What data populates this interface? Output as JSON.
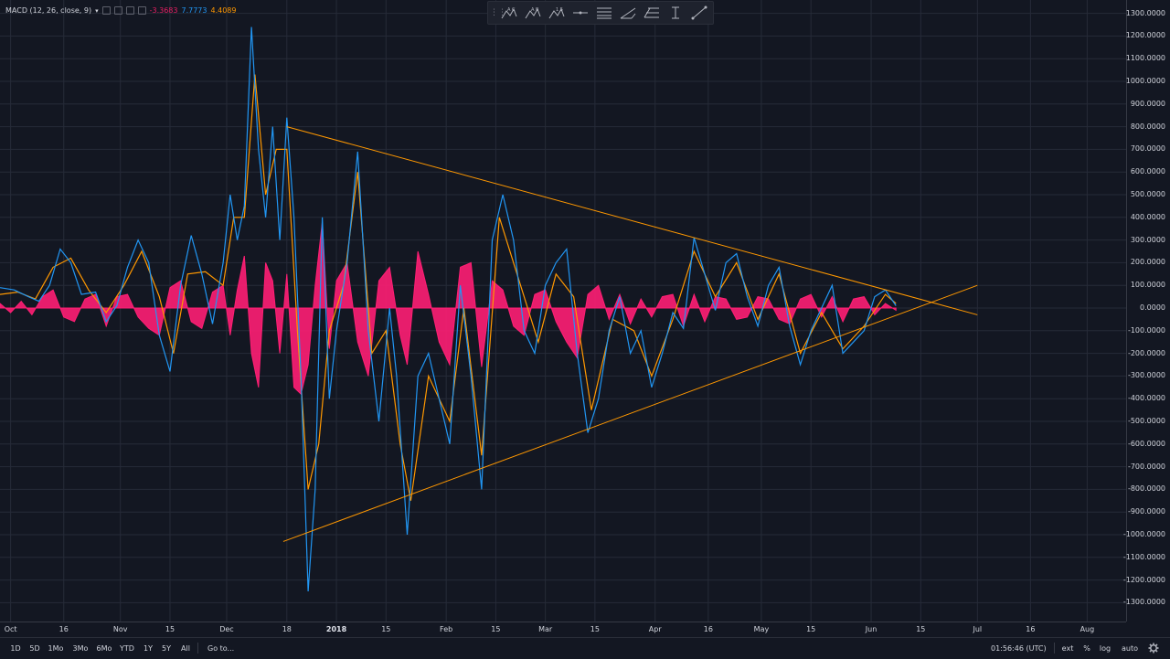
{
  "indicator": {
    "name": "MACD (12, 26, close, 9)",
    "value_histogram": "-3.3683",
    "value_macd": "7.7773",
    "value_signal": "4.4089",
    "colors": {
      "histogram": "#ff1e74",
      "macd": "#2196f3",
      "signal": "#ff9800",
      "trendline": "#ff9800",
      "background": "#131722",
      "grid": "#262b38"
    }
  },
  "toolbar": {
    "icons": [
      "pattern-abcd-icon",
      "pattern-ab-icon",
      "pattern-15-icon",
      "horizontal-line-icon",
      "parallel-lines-icon",
      "pitchfork-icon",
      "fib-icon",
      "text-cursor-icon",
      "trend-line-icon"
    ]
  },
  "price_axis": {
    "ticks": [
      "1300.0000",
      "1200.0000",
      "1100.0000",
      "1000.0000",
      "900.0000",
      "800.0000",
      "700.0000",
      "600.0000",
      "500.0000",
      "400.0000",
      "300.0000",
      "200.0000",
      "100.0000",
      "0.0000",
      "-100.0000",
      "-200.0000",
      "-300.0000",
      "-400.0000",
      "-500.0000",
      "-600.0000",
      "-700.0000",
      "-800.0000",
      "-900.0000",
      "-1000.0000",
      "-1100.0000",
      "-1200.0000",
      "-1300.0000"
    ]
  },
  "time_axis": {
    "ticks": [
      {
        "label": "Oct",
        "major": false
      },
      {
        "label": "16",
        "major": false
      },
      {
        "label": "Nov",
        "major": false
      },
      {
        "label": "15",
        "major": false
      },
      {
        "label": "Dec",
        "major": false
      },
      {
        "label": "18",
        "major": false
      },
      {
        "label": "2018",
        "major": true
      },
      {
        "label": "15",
        "major": false
      },
      {
        "label": "Feb",
        "major": false
      },
      {
        "label": "15",
        "major": false
      },
      {
        "label": "Mar",
        "major": false
      },
      {
        "label": "15",
        "major": false
      },
      {
        "label": "Apr",
        "major": false
      },
      {
        "label": "16",
        "major": false
      },
      {
        "label": "May",
        "major": false
      },
      {
        "label": "15",
        "major": false
      },
      {
        "label": "Jun",
        "major": false
      },
      {
        "label": "15",
        "major": false
      },
      {
        "label": "Jul",
        "major": false
      },
      {
        "label": "16",
        "major": false
      },
      {
        "label": "Aug",
        "major": false
      }
    ]
  },
  "bottom_bar": {
    "ranges": [
      "1D",
      "5D",
      "1Mo",
      "3Mo",
      "6Mo",
      "YTD",
      "1Y",
      "5Y",
      "All"
    ],
    "goto": "Go to...",
    "clock": "01:56:46 (UTC)",
    "options": [
      "ext",
      "%",
      "log",
      "auto"
    ]
  },
  "chart_data": {
    "type": "line",
    "title": "",
    "xlabel": "",
    "ylabel": "",
    "ylim": [
      -1350,
      1350
    ],
    "x_range": [
      "2017-09-28",
      "2018-08-12"
    ],
    "grid": true,
    "series": [
      {
        "role": "macd",
        "points": [
          [
            "2017-09-28",
            90
          ],
          [
            "2017-10-02",
            80
          ],
          [
            "2017-10-06",
            50
          ],
          [
            "2017-10-09",
            30
          ],
          [
            "2017-10-12",
            100
          ],
          [
            "2017-10-15",
            260
          ],
          [
            "2017-10-18",
            200
          ],
          [
            "2017-10-21",
            60
          ],
          [
            "2017-10-25",
            70
          ],
          [
            "2017-10-28",
            -60
          ],
          [
            "2017-10-31",
            10
          ],
          [
            "2017-11-03",
            180
          ],
          [
            "2017-11-06",
            300
          ],
          [
            "2017-11-09",
            200
          ],
          [
            "2017-11-12",
            -120
          ],
          [
            "2017-11-15",
            -280
          ],
          [
            "2017-11-18",
            100
          ],
          [
            "2017-11-21",
            320
          ],
          [
            "2017-11-24",
            150
          ],
          [
            "2017-11-27",
            -70
          ],
          [
            "2017-11-30",
            200
          ],
          [
            "2017-12-02",
            500
          ],
          [
            "2017-12-04",
            300
          ],
          [
            "2017-12-06",
            450
          ],
          [
            "2017-12-08",
            1240
          ],
          [
            "2017-12-10",
            700
          ],
          [
            "2017-12-12",
            400
          ],
          [
            "2017-12-14",
            800
          ],
          [
            "2017-12-16",
            300
          ],
          [
            "2017-12-18",
            840
          ],
          [
            "2017-12-20",
            400
          ],
          [
            "2017-12-22",
            -300
          ],
          [
            "2017-12-24",
            -1250
          ],
          [
            "2017-12-26",
            -800
          ],
          [
            "2017-12-28",
            400
          ],
          [
            "2017-12-30",
            -400
          ],
          [
            "2018-01-01",
            -100
          ],
          [
            "2018-01-04",
            200
          ],
          [
            "2018-01-07",
            690
          ],
          [
            "2018-01-10",
            -100
          ],
          [
            "2018-01-13",
            -500
          ],
          [
            "2018-01-16",
            0
          ],
          [
            "2018-01-18",
            -300
          ],
          [
            "2018-01-21",
            -1000
          ],
          [
            "2018-01-24",
            -300
          ],
          [
            "2018-01-27",
            -200
          ],
          [
            "2018-01-30",
            -400
          ],
          [
            "2018-02-02",
            -600
          ],
          [
            "2018-02-05",
            100
          ],
          [
            "2018-02-08",
            -300
          ],
          [
            "2018-02-11",
            -800
          ],
          [
            "2018-02-14",
            300
          ],
          [
            "2018-02-17",
            500
          ],
          [
            "2018-02-20",
            300
          ],
          [
            "2018-02-23",
            -100
          ],
          [
            "2018-02-26",
            -200
          ],
          [
            "2018-03-01",
            100
          ],
          [
            "2018-03-04",
            200
          ],
          [
            "2018-03-07",
            260
          ],
          [
            "2018-03-10",
            -200
          ],
          [
            "2018-03-13",
            -550
          ],
          [
            "2018-03-16",
            -400
          ],
          [
            "2018-03-19",
            -100
          ],
          [
            "2018-03-22",
            50
          ],
          [
            "2018-03-25",
            -200
          ],
          [
            "2018-03-28",
            -100
          ],
          [
            "2018-03-31",
            -350
          ],
          [
            "2018-04-03",
            -200
          ],
          [
            "2018-04-06",
            -20
          ],
          [
            "2018-04-09",
            -90
          ],
          [
            "2018-04-12",
            310
          ],
          [
            "2018-04-15",
            150
          ],
          [
            "2018-04-18",
            -10
          ],
          [
            "2018-04-21",
            200
          ],
          [
            "2018-04-24",
            240
          ],
          [
            "2018-04-27",
            50
          ],
          [
            "2018-04-30",
            -80
          ],
          [
            "2018-05-03",
            100
          ],
          [
            "2018-05-06",
            180
          ],
          [
            "2018-05-09",
            -80
          ],
          [
            "2018-05-12",
            -250
          ],
          [
            "2018-05-15",
            -100
          ],
          [
            "2018-05-18",
            0
          ],
          [
            "2018-05-21",
            100
          ],
          [
            "2018-05-24",
            -200
          ],
          [
            "2018-05-27",
            -150
          ],
          [
            "2018-05-30",
            -100
          ],
          [
            "2018-06-02",
            50
          ],
          [
            "2018-06-05",
            80
          ],
          [
            "2018-06-08",
            10
          ]
        ]
      },
      {
        "role": "signal",
        "points": [
          [
            "2017-09-28",
            60
          ],
          [
            "2017-10-03",
            70
          ],
          [
            "2017-10-08",
            40
          ],
          [
            "2017-10-13",
            180
          ],
          [
            "2017-10-18",
            220
          ],
          [
            "2017-10-23",
            80
          ],
          [
            "2017-10-28",
            -20
          ],
          [
            "2017-11-02",
            100
          ],
          [
            "2017-11-07",
            250
          ],
          [
            "2017-11-12",
            50
          ],
          [
            "2017-11-16",
            -200
          ],
          [
            "2017-11-20",
            150
          ],
          [
            "2017-11-25",
            160
          ],
          [
            "2017-11-30",
            100
          ],
          [
            "2017-12-03",
            400
          ],
          [
            "2017-12-06",
            400
          ],
          [
            "2017-12-09",
            1030
          ],
          [
            "2017-12-12",
            500
          ],
          [
            "2017-12-15",
            700
          ],
          [
            "2017-12-18",
            700
          ],
          [
            "2017-12-21",
            -100
          ],
          [
            "2017-12-24",
            -800
          ],
          [
            "2017-12-27",
            -600
          ],
          [
            "2017-12-30",
            -100
          ],
          [
            "2018-01-03",
            100
          ],
          [
            "2018-01-07",
            600
          ],
          [
            "2018-01-11",
            -200
          ],
          [
            "2018-01-15",
            -100
          ],
          [
            "2018-01-19",
            -600
          ],
          [
            "2018-01-22",
            -850
          ],
          [
            "2018-01-27",
            -300
          ],
          [
            "2018-02-02",
            -500
          ],
          [
            "2018-02-06",
            0
          ],
          [
            "2018-02-11",
            -650
          ],
          [
            "2018-02-16",
            400
          ],
          [
            "2018-02-22",
            100
          ],
          [
            "2018-02-27",
            -150
          ],
          [
            "2018-03-04",
            150
          ],
          [
            "2018-03-09",
            50
          ],
          [
            "2018-03-14",
            -450
          ],
          [
            "2018-03-20",
            -50
          ],
          [
            "2018-03-26",
            -100
          ],
          [
            "2018-03-31",
            -300
          ],
          [
            "2018-04-06",
            -50
          ],
          [
            "2018-04-12",
            250
          ],
          [
            "2018-04-18",
            50
          ],
          [
            "2018-04-24",
            200
          ],
          [
            "2018-04-30",
            -50
          ],
          [
            "2018-05-06",
            150
          ],
          [
            "2018-05-12",
            -200
          ],
          [
            "2018-05-18",
            -20
          ],
          [
            "2018-05-24",
            -180
          ],
          [
            "2018-05-30",
            -80
          ],
          [
            "2018-06-05",
            60
          ],
          [
            "2018-06-08",
            20
          ]
        ]
      },
      {
        "role": "histogram",
        "points": [
          [
            "2017-09-28",
            20
          ],
          [
            "2017-10-01",
            -20
          ],
          [
            "2017-10-04",
            30
          ],
          [
            "2017-10-07",
            -30
          ],
          [
            "2017-10-10",
            50
          ],
          [
            "2017-10-13",
            80
          ],
          [
            "2017-10-16",
            -40
          ],
          [
            "2017-10-19",
            -60
          ],
          [
            "2017-10-22",
            40
          ],
          [
            "2017-10-25",
            60
          ],
          [
            "2017-10-28",
            -80
          ],
          [
            "2017-10-31",
            50
          ],
          [
            "2017-11-03",
            60
          ],
          [
            "2017-11-06",
            -40
          ],
          [
            "2017-11-09",
            -90
          ],
          [
            "2017-11-12",
            -120
          ],
          [
            "2017-11-15",
            90
          ],
          [
            "2017-11-18",
            120
          ],
          [
            "2017-11-21",
            -60
          ],
          [
            "2017-11-24",
            -90
          ],
          [
            "2017-11-27",
            70
          ],
          [
            "2017-11-30",
            100
          ],
          [
            "2017-12-02",
            -120
          ],
          [
            "2017-12-04",
            80
          ],
          [
            "2017-12-06",
            230
          ],
          [
            "2017-12-08",
            -200
          ],
          [
            "2017-12-10",
            -350
          ],
          [
            "2017-12-12",
            200
          ],
          [
            "2017-12-14",
            120
          ],
          [
            "2017-12-16",
            -200
          ],
          [
            "2017-12-18",
            150
          ],
          [
            "2017-12-20",
            -350
          ],
          [
            "2017-12-22",
            -380
          ],
          [
            "2017-12-24",
            -250
          ],
          [
            "2017-12-26",
            100
          ],
          [
            "2017-12-28",
            380
          ],
          [
            "2017-12-30",
            -180
          ],
          [
            "2018-01-01",
            120
          ],
          [
            "2018-01-04",
            200
          ],
          [
            "2018-01-07",
            -150
          ],
          [
            "2018-01-10",
            -300
          ],
          [
            "2018-01-13",
            120
          ],
          [
            "2018-01-16",
            180
          ],
          [
            "2018-01-19",
            -120
          ],
          [
            "2018-01-21",
            -250
          ],
          [
            "2018-01-24",
            250
          ],
          [
            "2018-01-27",
            60
          ],
          [
            "2018-01-30",
            -150
          ],
          [
            "2018-02-02",
            -250
          ],
          [
            "2018-02-05",
            180
          ],
          [
            "2018-02-08",
            200
          ],
          [
            "2018-02-11",
            -260
          ],
          [
            "2018-02-14",
            120
          ],
          [
            "2018-02-17",
            80
          ],
          [
            "2018-02-20",
            -80
          ],
          [
            "2018-02-23",
            -120
          ],
          [
            "2018-02-26",
            60
          ],
          [
            "2018-03-01",
            80
          ],
          [
            "2018-03-04",
            -60
          ],
          [
            "2018-03-07",
            -150
          ],
          [
            "2018-03-10",
            -220
          ],
          [
            "2018-03-13",
            60
          ],
          [
            "2018-03-16",
            100
          ],
          [
            "2018-03-19",
            -50
          ],
          [
            "2018-03-22",
            60
          ],
          [
            "2018-03-25",
            -70
          ],
          [
            "2018-03-28",
            40
          ],
          [
            "2018-03-31",
            -40
          ],
          [
            "2018-04-03",
            50
          ],
          [
            "2018-04-06",
            60
          ],
          [
            "2018-04-09",
            -80
          ],
          [
            "2018-04-12",
            60
          ],
          [
            "2018-04-15",
            -60
          ],
          [
            "2018-04-18",
            50
          ],
          [
            "2018-04-21",
            40
          ],
          [
            "2018-04-24",
            -50
          ],
          [
            "2018-04-27",
            -40
          ],
          [
            "2018-04-30",
            50
          ],
          [
            "2018-05-03",
            40
          ],
          [
            "2018-05-06",
            -50
          ],
          [
            "2018-05-09",
            -70
          ],
          [
            "2018-05-12",
            40
          ],
          [
            "2018-05-15",
            60
          ],
          [
            "2018-05-18",
            -40
          ],
          [
            "2018-05-21",
            50
          ],
          [
            "2018-05-24",
            -60
          ],
          [
            "2018-05-27",
            40
          ],
          [
            "2018-05-30",
            50
          ],
          [
            "2018-06-02",
            -30
          ],
          [
            "2018-06-05",
            20
          ],
          [
            "2018-06-08",
            -10
          ]
        ]
      }
    ],
    "trendlines": [
      {
        "from": [
          "2017-12-18",
          800
        ],
        "to": [
          "2018-07-01",
          -30
        ]
      },
      {
        "from": [
          "2017-12-17",
          -1030
        ],
        "to": [
          "2018-07-01",
          100
        ]
      }
    ]
  }
}
